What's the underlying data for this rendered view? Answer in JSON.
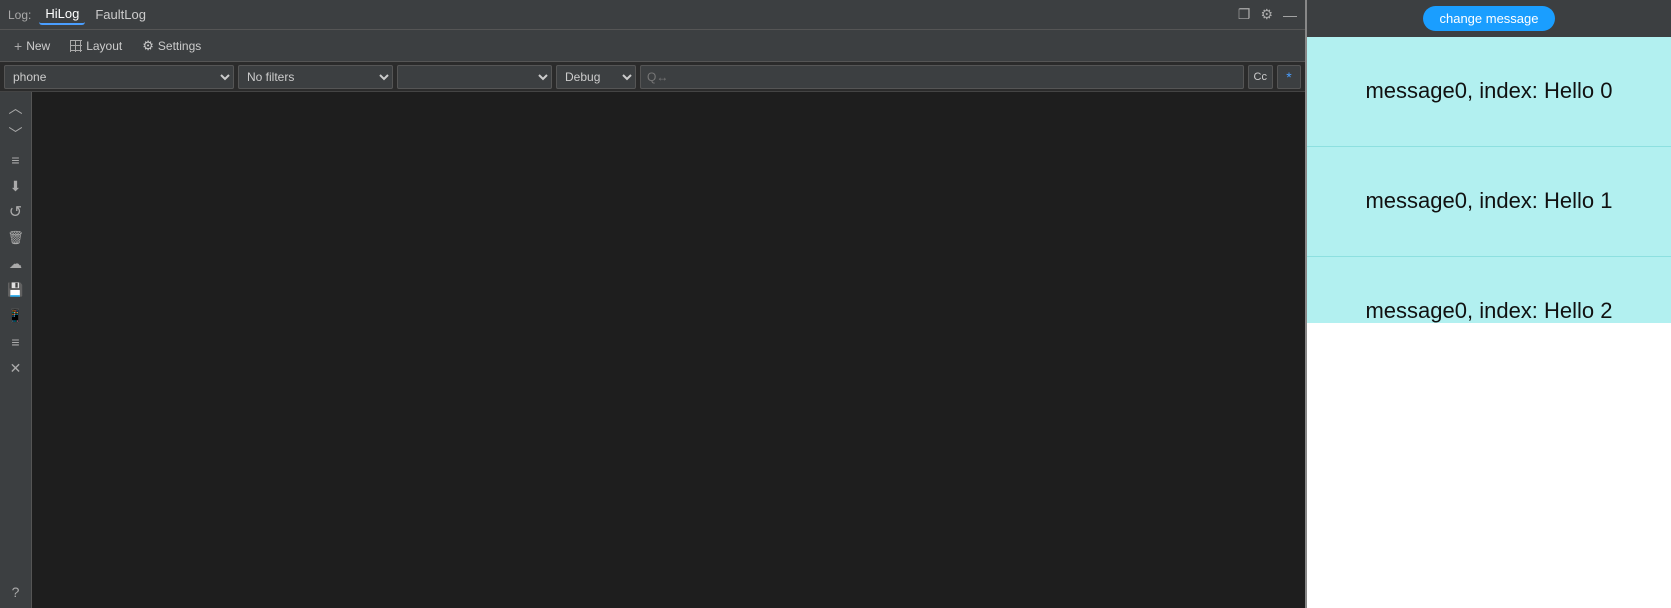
{
  "menu": {
    "label": "Log:",
    "items": [
      {
        "id": "hilog",
        "label": "HiLog",
        "active": true
      },
      {
        "id": "faultlog",
        "label": "FaultLog",
        "active": false
      }
    ]
  },
  "toolbar": {
    "new_label": "New",
    "layout_label": "Layout",
    "settings_label": "Settings"
  },
  "filter_bar": {
    "device_value": "phone",
    "device_placeholder": "phone",
    "no_filters_value": "No filters",
    "tag_placeholder": "",
    "level_value": "Debug",
    "search_placeholder": "Q↔",
    "cc_label": "Cc",
    "regex_label": "*"
  },
  "side_icons": [
    {
      "id": "chevron-up",
      "symbol": "︿"
    },
    {
      "id": "chevron-down",
      "symbol": "﹀"
    },
    {
      "id": "filter-icon",
      "symbol": "≡"
    },
    {
      "id": "download-icon",
      "symbol": "⬇"
    },
    {
      "id": "refresh-icon",
      "symbol": "↺"
    },
    {
      "id": "trash-icon",
      "symbol": "🗑"
    },
    {
      "id": "cloud-icon",
      "symbol": "☁"
    },
    {
      "id": "save-icon",
      "symbol": "💾"
    },
    {
      "id": "phone-icon",
      "symbol": "📱"
    },
    {
      "id": "list-icon",
      "symbol": "≡"
    },
    {
      "id": "close-icon",
      "symbol": "✕"
    },
    {
      "id": "help-icon",
      "symbol": "?"
    }
  ],
  "phone": {
    "change_message_btn": "change message",
    "messages": [
      {
        "id": 0,
        "text": "message0, index: Hello 0"
      },
      {
        "id": 1,
        "text": "message0, index: Hello 1"
      },
      {
        "id": 2,
        "text": "message0, index: Hello 2"
      }
    ]
  },
  "window_controls": {
    "restore": "❐",
    "settings": "⚙",
    "minimize": "—"
  }
}
